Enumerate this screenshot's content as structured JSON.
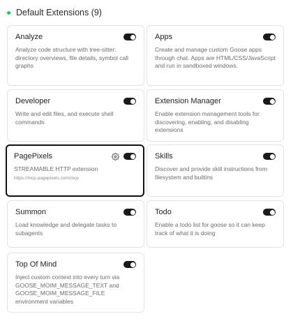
{
  "section": {
    "title": "Default Extensions (9)",
    "status_color": "#22c55e"
  },
  "extensions": [
    {
      "name": "Analyze",
      "description": "Analyze code structure with tree-sitter: directory overviews, file details, symbol call graphs",
      "enabled": true
    },
    {
      "name": "Apps",
      "description": "Create and manage custom Goose apps through chat. Apps are HTML/CSS/JavaScript and run in sandboxed windows.",
      "enabled": true
    },
    {
      "name": "Developer",
      "description": "Write and edit files, and execute shell commands",
      "enabled": true
    },
    {
      "name": "Extension Manager",
      "description": "Enable extension management tools for discovering, enabling, and disabling extensions",
      "enabled": true
    },
    {
      "name": "PagePixels",
      "description": "STREAMABLE HTTP extension",
      "url": "https://mcp.pagepixels.com/mcp",
      "enabled": true,
      "configurable": true,
      "selected": true
    },
    {
      "name": "Skills",
      "description": "Discover and provide skill instructions from filesystem and builtins",
      "enabled": true
    },
    {
      "name": "Summon",
      "description": "Load knowledge and delegate tasks to subagents",
      "enabled": true
    },
    {
      "name": "Todo",
      "description": "Enable a todo list for goose so it can keep track of what it is doing",
      "enabled": true
    },
    {
      "name": "Top Of Mind",
      "description": "Inject custom context into every turn via GOOSE_MOIM_MESSAGE_TEXT and GOOSE_MOIM_MESSAGE_FILE environment variables",
      "enabled": true
    }
  ]
}
